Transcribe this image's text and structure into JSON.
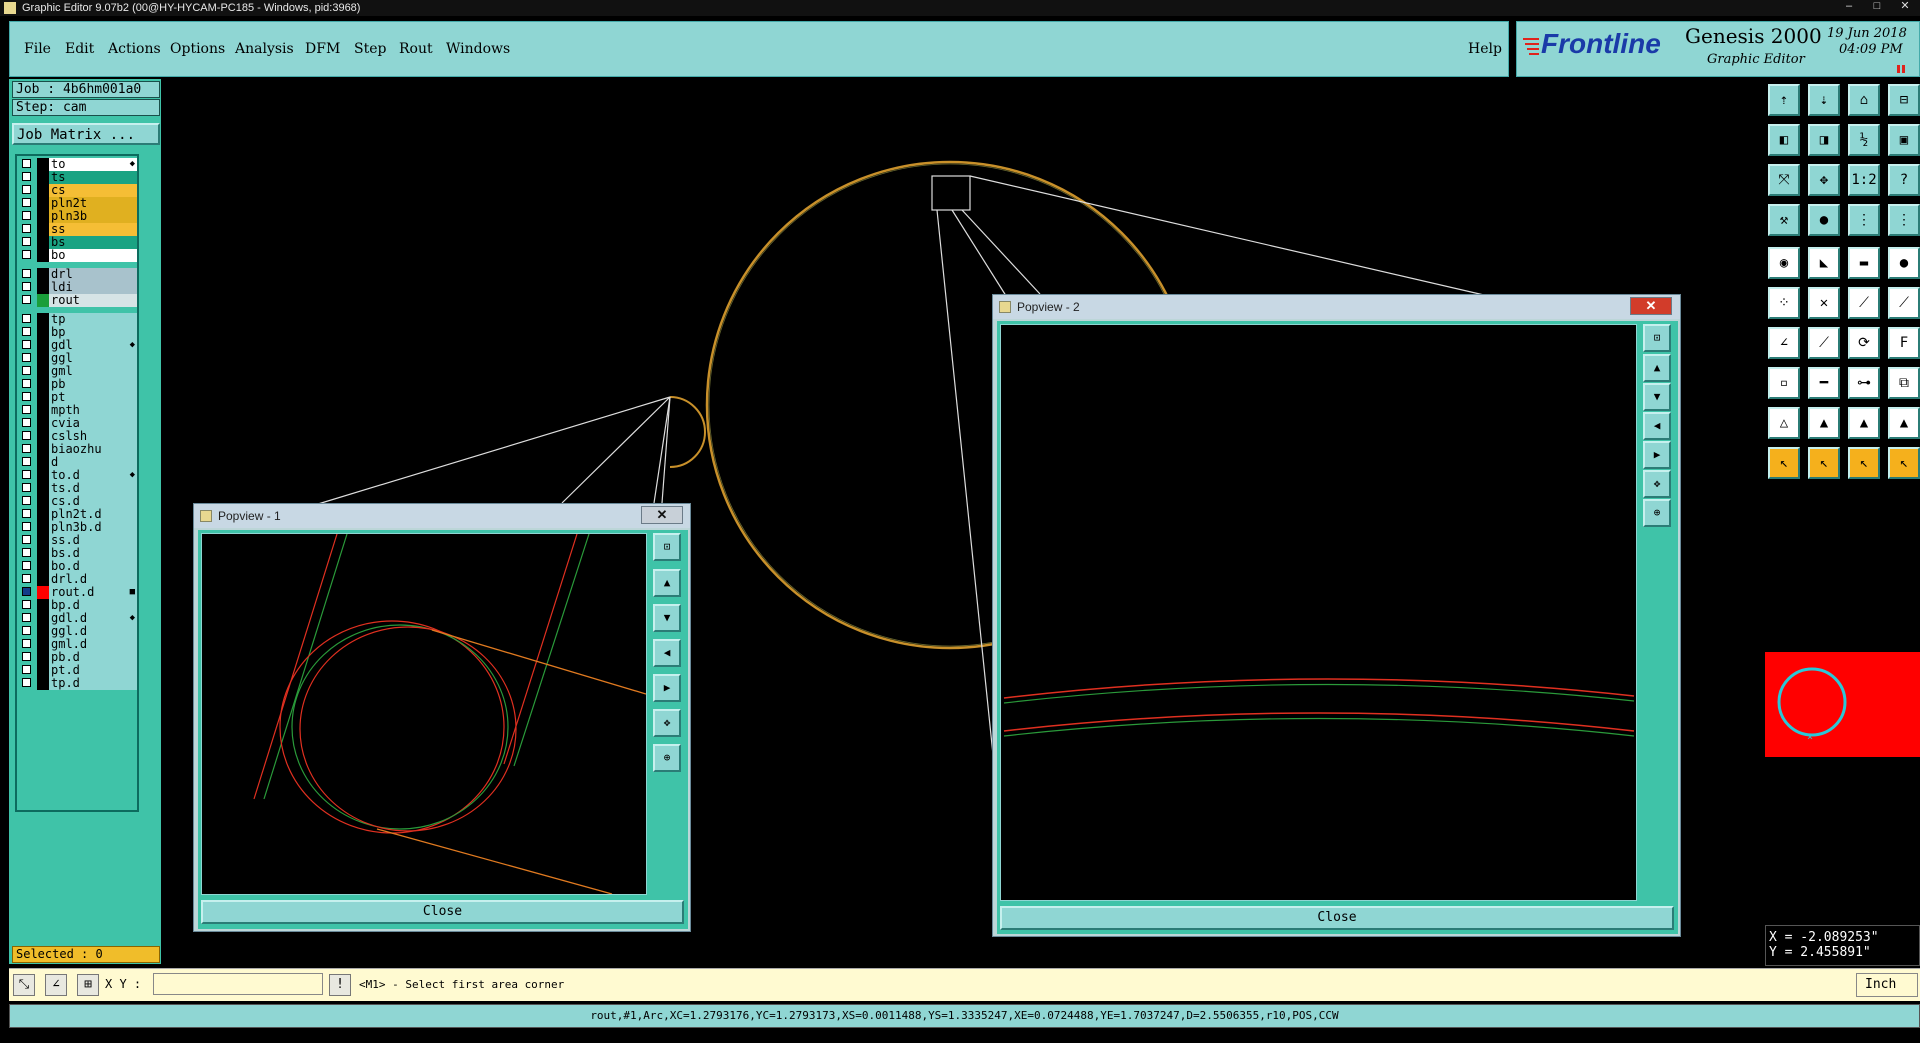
{
  "window": {
    "title": "Graphic Editor 9.07b2 (00@HY-HYCAM-PC185 - Windows, pid:3968)"
  },
  "menu": {
    "items": [
      "File",
      "Edit",
      "Actions",
      "Options",
      "Analysis",
      "DFM",
      "Step",
      "Rout",
      "Windows"
    ],
    "help": "Help"
  },
  "brand": {
    "logo": "Frontline",
    "product": "Genesis 2000",
    "subtitle": "Graphic Editor",
    "date": "19 Jun 2018",
    "time": "04:09 PM"
  },
  "job": {
    "job_label": "Job : 4b6hm001a0",
    "step_label": "Step: cam",
    "matrix_button": "Job Matrix ..."
  },
  "layers": [
    {
      "name": "to",
      "color": "#ffffff",
      "checked": false,
      "icon": "◆"
    },
    {
      "name": "ts",
      "color": "#1aa383",
      "checked": false
    },
    {
      "name": "cs",
      "color": "#f5be35",
      "checked": false
    },
    {
      "name": "pln2t",
      "color": "#e0b020",
      "checked": false
    },
    {
      "name": "pln3b",
      "color": "#e0b020",
      "checked": false
    },
    {
      "name": "ss",
      "color": "#f5be35",
      "checked": false
    },
    {
      "name": "bs",
      "color": "#1aa383",
      "checked": false
    },
    {
      "name": "bo",
      "color": "#ffffff",
      "checked": false
    },
    {
      "name": "drl",
      "color": "#a8c2cc",
      "checked": false
    },
    {
      "name": "ldi",
      "color": "#a8c2cc",
      "checked": false
    },
    {
      "name": "rout",
      "color": "#d6e4e6",
      "checked": false,
      "swatch": "#1a9e3a"
    },
    {
      "name": "tp",
      "color": "#8fd6d3",
      "checked": false
    },
    {
      "name": "bp",
      "color": "#8fd6d3",
      "checked": false
    },
    {
      "name": "gdl",
      "color": "#8fd6d3",
      "checked": false,
      "icon": "◆"
    },
    {
      "name": "ggl",
      "color": "#8fd6d3",
      "checked": false
    },
    {
      "name": "gml",
      "color": "#8fd6d3",
      "checked": false
    },
    {
      "name": "pb",
      "color": "#8fd6d3",
      "checked": false
    },
    {
      "name": "pt",
      "color": "#8fd6d3",
      "checked": false
    },
    {
      "name": "mpth",
      "color": "#8fd6d3",
      "checked": false
    },
    {
      "name": "cvia",
      "color": "#8fd6d3",
      "checked": false
    },
    {
      "name": "cslsh",
      "color": "#8fd6d3",
      "checked": false
    },
    {
      "name": "biaozhu",
      "color": "#8fd6d3",
      "checked": false
    },
    {
      "name": "d",
      "color": "#8fd6d3",
      "checked": false
    },
    {
      "name": "to.d",
      "color": "#8fd6d3",
      "checked": false,
      "icon": "◆"
    },
    {
      "name": "ts.d",
      "color": "#8fd6d3",
      "checked": false
    },
    {
      "name": "cs.d",
      "color": "#8fd6d3",
      "checked": false
    },
    {
      "name": "pln2t.d",
      "color": "#8fd6d3",
      "checked": false
    },
    {
      "name": "pln3b.d",
      "color": "#8fd6d3",
      "checked": false
    },
    {
      "name": "ss.d",
      "color": "#8fd6d3",
      "checked": false
    },
    {
      "name": "bs.d",
      "color": "#8fd6d3",
      "checked": false
    },
    {
      "name": "bo.d",
      "color": "#8fd6d3",
      "checked": false
    },
    {
      "name": "drl.d",
      "color": "#8fd6d3",
      "checked": false
    },
    {
      "name": "rout.d",
      "color": "#8fd6d3",
      "checked": true,
      "swatch": "#ff0000",
      "icon": "■"
    },
    {
      "name": "bp.d",
      "color": "#8fd6d3",
      "checked": false
    },
    {
      "name": "gdl.d",
      "color": "#8fd6d3",
      "checked": false,
      "icon": "◆"
    },
    {
      "name": "ggl.d",
      "color": "#8fd6d3",
      "checked": false
    },
    {
      "name": "gml.d",
      "color": "#8fd6d3",
      "checked": false
    },
    {
      "name": "pb.d",
      "color": "#8fd6d3",
      "checked": false
    },
    {
      "name": "pt.d",
      "color": "#8fd6d3",
      "checked": false
    },
    {
      "name": "tp.d",
      "color": "#8fd6d3",
      "checked": false
    }
  ],
  "selected": "Selected : 0",
  "popview1": {
    "title": "Popview - 1",
    "close_label": "Close"
  },
  "popview2": {
    "title": "Popview - 2",
    "close_label": "Close"
  },
  "coords": {
    "x": "X = -2.089253\"",
    "y": "Y = 2.455891\""
  },
  "command": {
    "xy_label": "X Y :",
    "xy_value": "",
    "prompt": "<M1> - Select first area corner",
    "units": "Inch"
  },
  "status": "rout,#1,Arc,XC=1.2793176,YC=1.2793173,XS=0.0011488,YS=1.3335247,XE=0.0724488,YE=1.7037247,D=2.5506355,r10,POS,CCW",
  "colors": {
    "panel": "#8fd6d3",
    "teal": "#3fc3a8",
    "accent_red": "#ff0000",
    "arc": "#c8902a"
  }
}
